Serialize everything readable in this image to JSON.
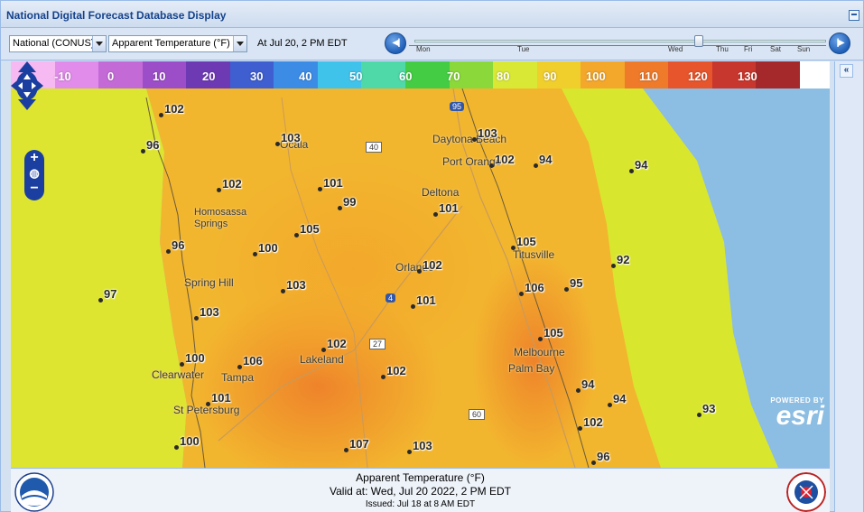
{
  "window": {
    "title": "National Digital Forecast Database Display"
  },
  "toolbar": {
    "region_select": "National (CONUS)",
    "element_select": "Apparent Temperature (°F)",
    "valid_time_label": "At Jul 20,   2 PM EDT",
    "timeline_days": [
      "Mon",
      "Tue",
      "Wed",
      "Thu",
      "Fri",
      "Sat",
      "Sun"
    ],
    "timeline_position": 0.69
  },
  "legend": {
    "labels": [
      "-10",
      "0",
      "10",
      "20",
      "30",
      "40",
      "50",
      "60",
      "70",
      "80",
      "90",
      "100",
      "110",
      "120",
      "130"
    ],
    "colors": [
      "#f6b9f1",
      "#e18cea",
      "#c36ad7",
      "#9c4ec8",
      "#6e3ab4",
      "#3f5fd0",
      "#3c8ce6",
      "#40c3ea",
      "#4fd8a8",
      "#44cd44",
      "#8ad83a",
      "#d9e834",
      "#f0ce2c",
      "#f3a72b",
      "#ee7a2a",
      "#e6552c",
      "#c8372d",
      "#a5282a"
    ]
  },
  "map": {
    "places": [
      {
        "name": "Ocala"
      },
      {
        "name": "Daytona Beach"
      },
      {
        "name": "Port Orange"
      },
      {
        "name": "Deltona"
      },
      {
        "name": "Homosassa Springs"
      },
      {
        "name": "Titusville"
      },
      {
        "name": "Orlando"
      },
      {
        "name": "Spring Hill"
      },
      {
        "name": "Melbourne"
      },
      {
        "name": "Palm Bay"
      },
      {
        "name": "Lakeland"
      },
      {
        "name": "Clearwater"
      },
      {
        "name": "Tampa"
      },
      {
        "name": "St Petersburg"
      }
    ],
    "road_shields": [
      "95",
      "40",
      "4",
      "27",
      "60"
    ],
    "values": [
      "102",
      "96",
      "103",
      "103",
      "102",
      "94",
      "94",
      "102",
      "101",
      "99",
      "101",
      "105",
      "96",
      "100",
      "105",
      "102",
      "92",
      "97",
      "103",
      "106",
      "95",
      "101",
      "103",
      "105",
      "100",
      "102",
      "106",
      "102",
      "94",
      "101",
      "94",
      "102",
      "93",
      "107",
      "100",
      "103",
      "96"
    ],
    "attribution": {
      "powered_by": "POWERED BY",
      "brand": "esri"
    }
  },
  "footer": {
    "title": "Apparent Temperature (°F)",
    "valid_at": "Valid at:  Wed, Jul 20 2022,    2 PM EDT",
    "issued": "Issued: Jul 18 at 8 AM EDT"
  }
}
